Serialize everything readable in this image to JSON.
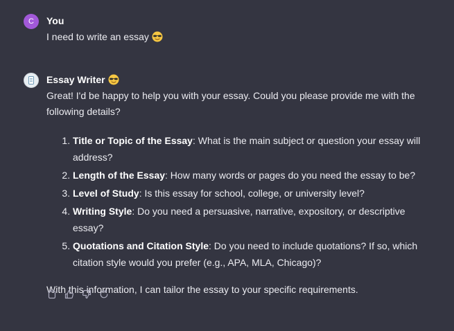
{
  "user_message": {
    "avatar_letter": "C",
    "author": "You",
    "text": "I need to write an essay"
  },
  "bot_message": {
    "author": "Essay Writer",
    "intro": "Great! I'd be happy to help you with your essay. Could you please provide me with the following details?",
    "items": [
      {
        "label": "Title or Topic of the Essay",
        "text": ": What is the main subject or question your essay will address?"
      },
      {
        "label": "Length of the Essay",
        "text": ": How many words or pages do you need the essay to be?"
      },
      {
        "label": "Level of Study",
        "text": ": Is this essay for school, college, or university level?"
      },
      {
        "label": "Writing Style",
        "text": ": Do you need a persuasive, narrative, expository, or descriptive essay?"
      },
      {
        "label": "Quotations and Citation Style",
        "text": ": Do you need to include quotations? If so, which citation style would you prefer (e.g., APA, MLA, Chicago)?"
      }
    ],
    "closing": "With this information, I can tailor the essay to your specific requirements."
  },
  "actions": [
    "copy-icon",
    "thumbs-up-icon",
    "thumbs-down-icon",
    "regenerate-icon"
  ],
  "colors": {
    "background": "#343541",
    "text": "#ececf1",
    "user_avatar": "#a259d9"
  }
}
